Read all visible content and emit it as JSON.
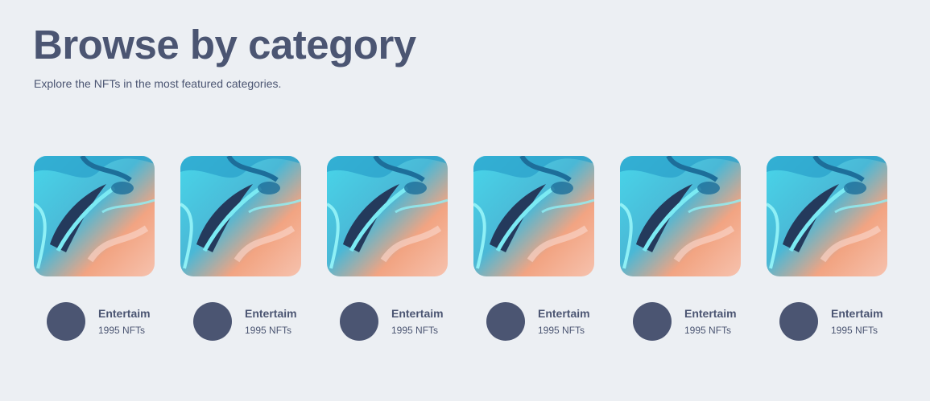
{
  "header": {
    "title": "Browse by category",
    "subtitle": "Explore the NFTs in the most featured categories."
  },
  "categories": [
    {
      "name": "Entertaim",
      "count": "1995 NFTs",
      "image": "abstract-artwork"
    },
    {
      "name": "Entertaim",
      "count": "1995 NFTs",
      "image": "abstract-artwork"
    },
    {
      "name": "Entertaim",
      "count": "1995 NFTs",
      "image": "abstract-artwork"
    },
    {
      "name": "Entertaim",
      "count": "1995 NFTs",
      "image": "abstract-artwork"
    },
    {
      "name": "Entertaim",
      "count": "1995 NFTs",
      "image": "abstract-artwork"
    },
    {
      "name": "Entertaim",
      "count": "1995 NFTs",
      "image": "abstract-artwork"
    }
  ],
  "colors": {
    "background": "#eceff3",
    "text": "#4b5572",
    "avatar": "#4b5572",
    "art_cyan": "#48d6ea",
    "art_blue": "#1d6e9a",
    "art_navy": "#243a5c",
    "art_peach": "#f5a47a",
    "art_pink": "#f2c0b4"
  }
}
